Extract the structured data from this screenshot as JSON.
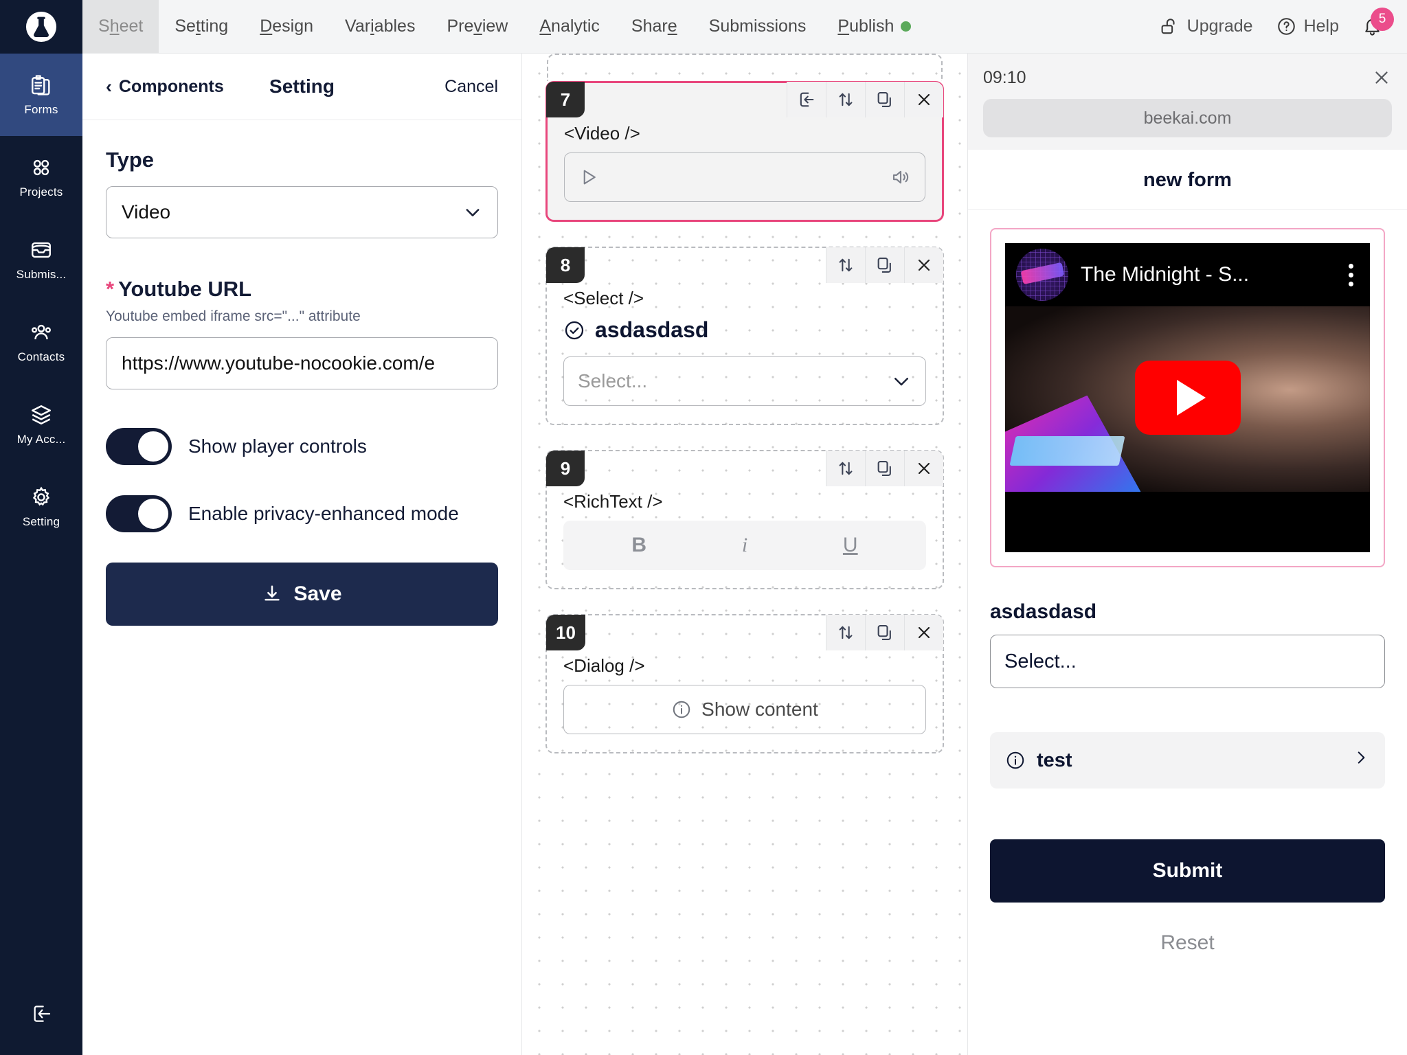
{
  "rail": {
    "logo_icon": "flask-logo-icon",
    "items": [
      {
        "label": "Forms",
        "icon": "forms-clipboard-icon",
        "active": true
      },
      {
        "label": "Projects",
        "icon": "projects-grid-icon",
        "active": false
      },
      {
        "label": "Submis...",
        "icon": "submissions-tray-icon",
        "active": false
      },
      {
        "label": "Contacts",
        "icon": "contacts-people-icon",
        "active": false
      },
      {
        "label": "My Acc...",
        "icon": "layers-account-icon",
        "active": false
      },
      {
        "label": "Setting",
        "icon": "gear-icon",
        "active": false
      }
    ],
    "logout_icon": "logout-icon"
  },
  "topbar": {
    "tabs": [
      {
        "label": "Sheet",
        "accel": "h",
        "active": true
      },
      {
        "label": "Setting",
        "accel": "t",
        "active": false
      },
      {
        "label": "Design",
        "accel": "D",
        "active": false
      },
      {
        "label": "Variables",
        "accel": "i",
        "active": false
      },
      {
        "label": "Preview",
        "accel": "v",
        "active": false
      },
      {
        "label": "Analytic",
        "accel": "A",
        "active": false
      },
      {
        "label": "Share",
        "accel": "e",
        "active": false
      },
      {
        "label": "Submissions",
        "accel": "",
        "active": false
      },
      {
        "label": "Publish",
        "accel": "P",
        "active": false,
        "dot": true
      }
    ],
    "upgrade_label": "Upgrade",
    "help_label": "Help",
    "notification_count": "5",
    "publish_dot_color": "#5ba95b",
    "badge_color": "#eb4d8b"
  },
  "panel": {
    "back_label": "Components",
    "title": "Setting",
    "cancel_label": "Cancel",
    "type_label": "Type",
    "type_value": "Video",
    "url_label": "Youtube URL",
    "url_required_mark": "*",
    "url_hint": "Youtube embed iframe src=\"...\" attribute",
    "url_value": "https://www.youtube-nocookie.com/e",
    "toggles": [
      {
        "label": "Show player controls",
        "on": true
      },
      {
        "label": "Enable privacy-enhanced mode",
        "on": true
      }
    ],
    "save_label": "Save"
  },
  "canvas": {
    "blocks": [
      {
        "number": "7",
        "tag": "<Video />",
        "selected": true,
        "tools": [
          "insert-icon",
          "reorder-icon",
          "duplicate-icon",
          "close-icon"
        ],
        "inner": {
          "kind": "video-player",
          "play_icon": "play-icon",
          "volume_icon": "volume-icon"
        }
      },
      {
        "number": "8",
        "tag": "<Select />",
        "selected": false,
        "tools": [
          "reorder-icon",
          "duplicate-icon",
          "close-icon"
        ],
        "sub_label": "asdasdasd",
        "sub_icon": "check-circle-icon",
        "inner": {
          "kind": "select",
          "placeholder": "Select..."
        }
      },
      {
        "number": "9",
        "tag": "<RichText />",
        "selected": false,
        "tools": [
          "reorder-icon",
          "duplicate-icon",
          "close-icon"
        ],
        "inner": {
          "kind": "richtext",
          "bold": "B",
          "italic": "i",
          "underline": "U"
        }
      },
      {
        "number": "10",
        "tag": "<Dialog />",
        "selected": false,
        "tools": [
          "reorder-icon",
          "duplicate-icon",
          "close-icon"
        ],
        "inner": {
          "kind": "dialog",
          "button_label": "Show content",
          "info_icon": "info-circle-icon"
        }
      }
    ]
  },
  "preview": {
    "time": "09:10",
    "close_icon": "close-icon",
    "url": "beekai.com",
    "form_title": "new form",
    "video": {
      "title": "The Midnight - S...",
      "play_icon": "youtube-play-icon",
      "kebab_icon": "more-vertical-icon"
    },
    "field_label": "asdasdasd",
    "select_placeholder": "Select...",
    "dialog_label": "test",
    "dialog_info_icon": "info-circle-icon",
    "dialog_chevron_icon": "chevron-right-icon",
    "submit_label": "Submit",
    "reset_label": "Reset"
  },
  "colors": {
    "rail_bg": "#0f1a31",
    "rail_active": "#31497f",
    "accent_pink": "#e8467c",
    "dark_navy": "#0d1530",
    "save_navy": "#1d2a4d"
  }
}
